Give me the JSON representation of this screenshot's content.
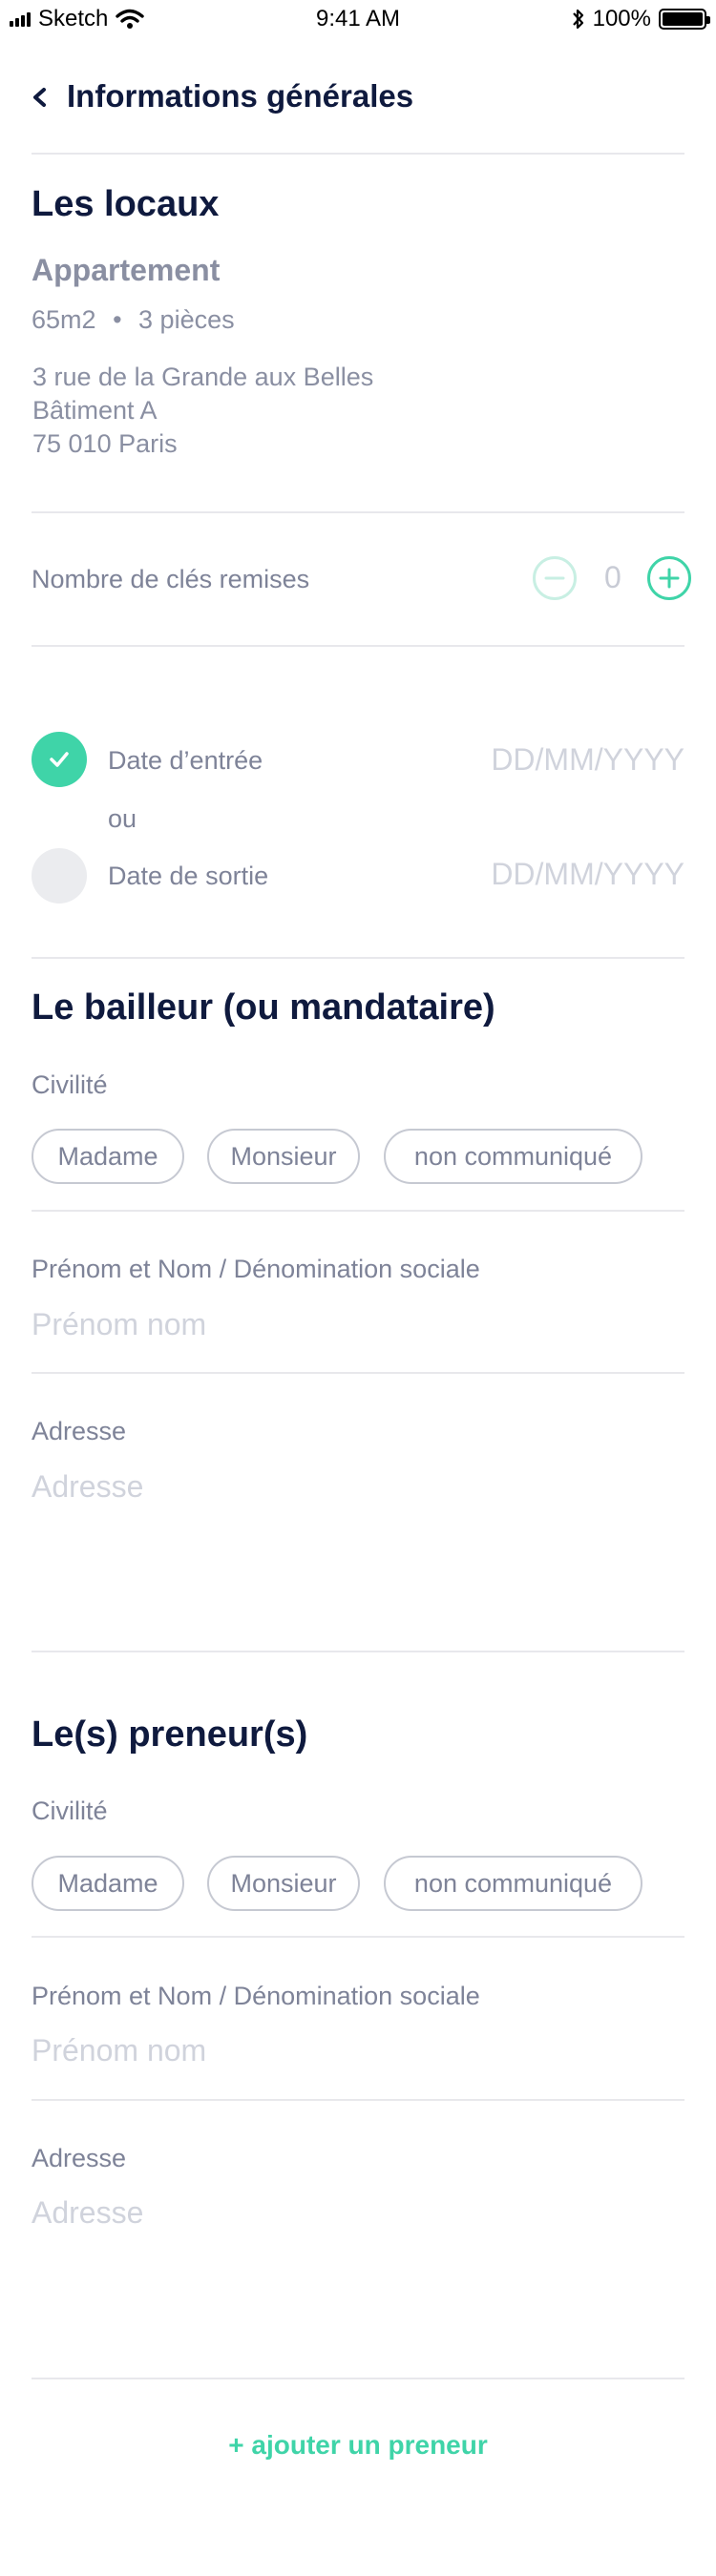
{
  "status_bar": {
    "carrier": "Sketch",
    "time": "9:41 AM",
    "battery": "100%"
  },
  "header": {
    "title": "Informations générales"
  },
  "locaux": {
    "title": "Les locaux",
    "type": "Appartement",
    "surface": "65m2",
    "separator": "•",
    "rooms": "3 pièces",
    "address_lines": [
      "3 rue de la Grande aux Belles",
      "Bâtiment A",
      "75 010 Paris"
    ]
  },
  "keys": {
    "label": "Nombre de clés remises",
    "value": "0"
  },
  "dates": {
    "entry_label": "Date d’entrée",
    "entry_placeholder": "DD/MM/YYYY",
    "entry_selected": true,
    "or_label": "ou",
    "exit_label": "Date de sortie",
    "exit_placeholder": "DD/MM/YYYY",
    "exit_selected": false
  },
  "bailleur": {
    "title": "Le bailleur (ou mandataire)",
    "civility_label": "Civilité",
    "civility_options": [
      "Madame",
      "Monsieur",
      "non communiqué"
    ],
    "name_label": "Prénom et Nom / Dénomination sociale",
    "name_placeholder": "Prénom nom",
    "address_label": "Adresse",
    "address_placeholder": "Adresse"
  },
  "preneur": {
    "title": "Le(s) preneur(s)",
    "civility_label": "Civilité",
    "civility_options": [
      "Madame",
      "Monsieur",
      "non communiqué"
    ],
    "name_label": "Prénom et Nom / Dénomination sociale",
    "name_placeholder": "Prénom nom",
    "address_label": "Adresse",
    "address_placeholder": "Adresse"
  },
  "add_preneur": {
    "label": "+ ajouter un preneur"
  },
  "colors": {
    "accent": "#3fd4a8",
    "title": "#0f1a3e",
    "muted": "#8a8fa2",
    "placeholder": "#d0d3dc",
    "divider": "#e8e8ec"
  }
}
